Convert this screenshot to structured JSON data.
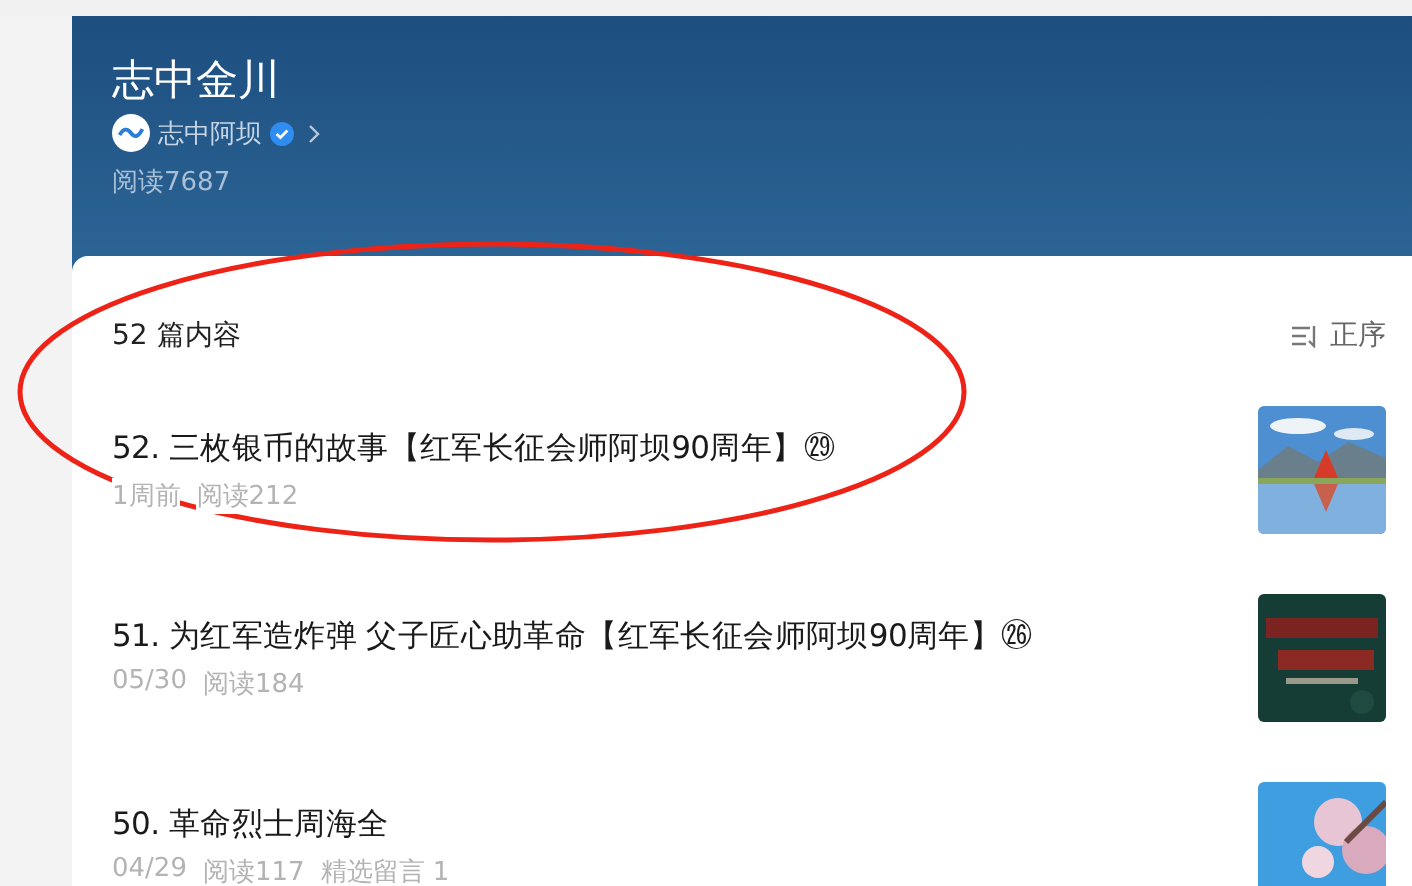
{
  "header": {
    "title": "志中金川",
    "author": "志中阿坝",
    "verified": true,
    "reads": "阅读7687"
  },
  "list": {
    "count": "52 篇内容",
    "sort": "正序"
  },
  "articles": [
    {
      "title": "52. 三枚银币的故事【红军长征会师阿坝90周年】㉙",
      "date": "1周前",
      "reads": "阅读212"
    },
    {
      "title": "51. 为红军造炸弹 父子匠心助革命【红军长征会师阿坝90周年】㉖",
      "date": "05/30",
      "reads": "阅读184"
    },
    {
      "title": "50. 革命烈士周海全",
      "date": "04/29",
      "reads": "阅读117",
      "comments": "精选留言 1"
    }
  ],
  "annotation": {
    "kind": "ellipse",
    "color": "#ee2318"
  }
}
